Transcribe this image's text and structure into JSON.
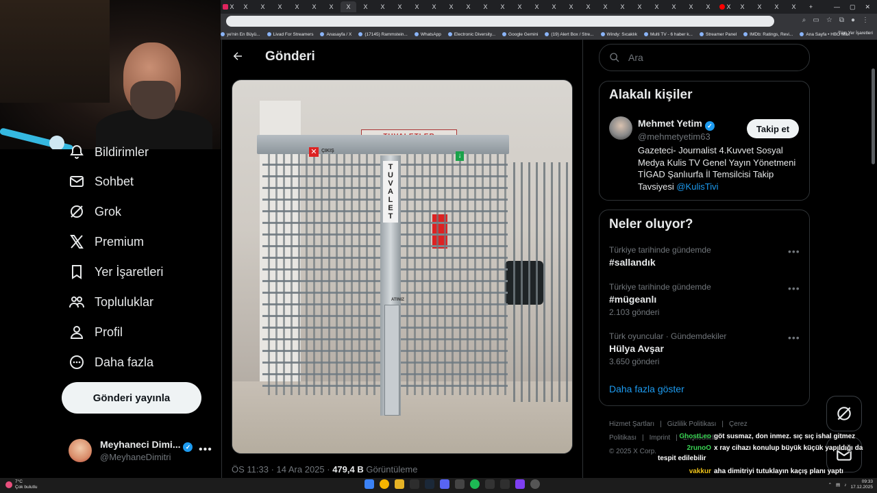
{
  "browser": {
    "tabs": [
      "X",
      "X",
      "X",
      "X",
      "X",
      "X",
      "X",
      "X",
      "X",
      "X",
      "X",
      "X",
      "X",
      "X",
      "X",
      "X",
      "X",
      "X",
      "X",
      "X",
      "X",
      "X",
      "X",
      "X",
      "X",
      "X",
      "X",
      "X",
      "X",
      "X",
      "X",
      "X",
      "X",
      "X",
      "+"
    ],
    "bookmarks": [
      "ye'nin En Büyü...",
      "Livad For Streamers",
      "Anasayfa / X",
      "(17145) Rammstein...",
      "WhatsApp",
      "Electronic Diversity...",
      "Google Gemini",
      "(19) Alert Box / Stre...",
      "Windy: Sıcaklık",
      "Multi TV - 6 haber k...",
      "Streamer Panel",
      "IMDb: Ratings, Revi...",
      "Ana Sayfa • HBO Max"
    ],
    "bookmarks_all": "Tüm Yer İşaretleri"
  },
  "nav": {
    "items": [
      {
        "label": "Bildirimler",
        "icon": "bell-icon"
      },
      {
        "label": "Sohbet",
        "icon": "mail-icon"
      },
      {
        "label": "Grok",
        "icon": "grok-icon"
      },
      {
        "label": "Premium",
        "icon": "x-logo-icon"
      },
      {
        "label": "Yer İşaretleri",
        "icon": "bookmark-icon"
      },
      {
        "label": "Topluluklar",
        "icon": "communities-icon"
      },
      {
        "label": "Profil",
        "icon": "person-icon"
      },
      {
        "label": "Daha fazla",
        "icon": "more-circle-icon"
      }
    ],
    "post_button": "Gönderi yayınla",
    "profile": {
      "name": "Meyhaneci Dimi...",
      "handle": "@MeyhaneDimitri"
    }
  },
  "post": {
    "header_title": "Gönderi",
    "image_texts": {
      "sign": "TUVALETLER",
      "pole": "TUVALET",
      "exit": "ÇIKIŞ",
      "coin": "ATINIZ"
    },
    "time": "ÖS 11:33 · 14 Ara 2025 · ",
    "views": "479,4 B",
    "views_label": " Görüntüleme"
  },
  "search": {
    "placeholder": "Ara"
  },
  "related": {
    "title": "Alakalı kişiler",
    "name": "Mehmet Yetim",
    "handle": "@mehmetyetim63",
    "follow": "Takip et",
    "bio": "Gazeteci- Journalist 4.Kuvvet Sosyal Medya Kulis TV Genel Yayın Yönetmeni TİGAD Şanlıurfa İl Temsilcisi Takip Tavsiyesi ",
    "bio_link": "@KulisTivi"
  },
  "trends": {
    "title": "Neler oluyor?",
    "items": [
      {
        "category": "Türkiye tarihinde gündemde",
        "name": "#sallandık",
        "count": ""
      },
      {
        "category": "Türkiye tarihinde gündemde",
        "name": "#mügeanlı",
        "count": "2.103 gönderi"
      },
      {
        "category": "Türk oyuncular · Gündemdekiler",
        "name": "Hülya Avşar",
        "count": "3.650 gönderi"
      }
    ],
    "show_more": "Daha fazla göster"
  },
  "footer": {
    "links": [
      "Hizmet Şartları",
      "|",
      "Gizlilik Politikası",
      "|",
      "Çerez Politikası",
      "|",
      "Imprint",
      "|",
      "Erişilebilirli..."
    ],
    "copyright": "© 2025 X Corp."
  },
  "chat": [
    {
      "user": "GhostLeo",
      "color": "#39d353",
      "text": "göt susmaz, don inmez. sıç sıç ishal gitmez"
    },
    {
      "user": "2runoO",
      "color": "#39d353",
      "text": "x ray cihazı konulup büyük küçük yapıldığı da tespit edilebilir"
    },
    {
      "user": "vakkur",
      "color": "#f0c419",
      "text": "aha dimitriyi tutuklayın kaçış planı yaptı"
    }
  ],
  "taskbar": {
    "weather_temp": "7°C",
    "weather_desc": "Çok bulutlu",
    "time": "09:33",
    "date": "17.12.2025"
  },
  "colors": {
    "accent": "#1d9bf0",
    "bg": "#000000",
    "border": "#2f3336",
    "muted": "#71767b"
  }
}
